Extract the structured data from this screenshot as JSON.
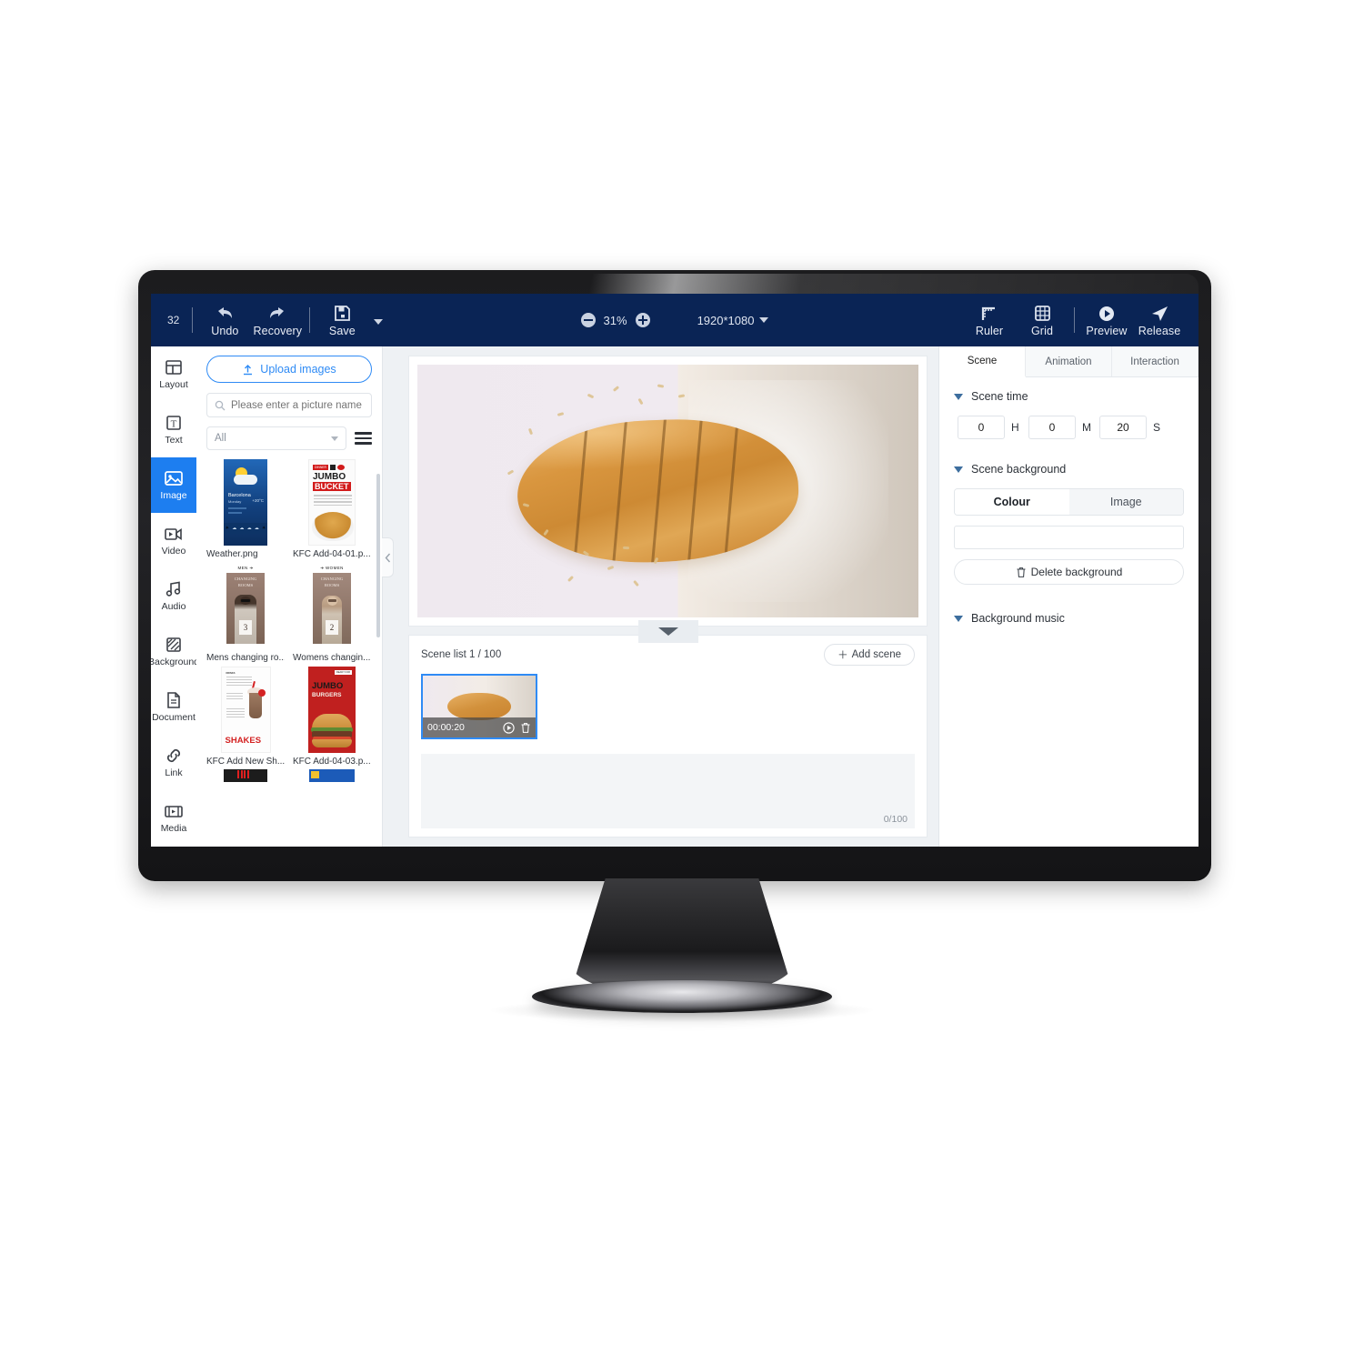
{
  "toolbar": {
    "left_number": "32",
    "undo_label": "Undo",
    "recovery_label": "Recovery",
    "save_label": "Save",
    "zoom_level": "31%",
    "resolution": "1920*1080",
    "ruler_label": "Ruler",
    "grid_label": "Grid",
    "preview_label": "Preview",
    "release_label": "Release",
    "bg_color": "#0a2455"
  },
  "rail": {
    "items": [
      {
        "label": "Layout",
        "icon": "layout-icon",
        "active": false
      },
      {
        "label": "Text",
        "icon": "text-icon",
        "active": false
      },
      {
        "label": "Image",
        "icon": "image-icon",
        "active": true
      },
      {
        "label": "Video",
        "icon": "video-icon",
        "active": false
      },
      {
        "label": "Audio",
        "icon": "audio-icon",
        "active": false
      },
      {
        "label": "Background",
        "icon": "background-icon",
        "active": false
      },
      {
        "label": "Document",
        "icon": "document-icon",
        "active": false
      },
      {
        "label": "Link",
        "icon": "link-icon",
        "active": false
      },
      {
        "label": "Media",
        "icon": "media-icon",
        "active": false
      }
    ],
    "active_color": "#1d7ef0"
  },
  "image_panel": {
    "upload_label": "Upload images",
    "search_placeholder": "Please enter a picture name",
    "filter_value": "All",
    "thumbnails": [
      {
        "name": "Weather.png",
        "kind": "weather-widget"
      },
      {
        "name": "KFC Add-04-01.p...",
        "kind": "jumbo-bucket"
      },
      {
        "name": "Mens changing ro...",
        "kind": "mens-changing-room"
      },
      {
        "name": "Womens changin...",
        "kind": "womens-changing-room"
      },
      {
        "name": "KFC Add New Sh...",
        "kind": "shakes-menu"
      },
      {
        "name": "KFC Add-04-03.p...",
        "kind": "jumbo-burgers"
      }
    ],
    "thumb_text": {
      "weather_city": "Barcelona",
      "weather_day": "Monday",
      "weather_temp": "+20°C",
      "bucket_brand": "DINNER",
      "bucket_line1": "JUMBO",
      "bucket_line2": "BUCKET",
      "men_tag": "MEN",
      "women_tag": "WOMEN",
      "changing_line1": "CHANGING",
      "changing_line2": "ROOMS",
      "men_number": "3",
      "women_number": "2",
      "shakes_title": "SHAKES",
      "burgers_tagline": "READY FOR",
      "burgers_line1": "JUMBO",
      "burgers_line2": "BURGERS"
    }
  },
  "canvas": {
    "image_alt": "Sliced artisan bread loaf with scattered oats on lavender and beige background"
  },
  "scene_panel": {
    "list_label": "Scene list 1 / 100",
    "add_scene_label": "Add scene",
    "scene_duration": "00:00:20",
    "drop_counter": "0/100"
  },
  "right_panel": {
    "tabs": [
      {
        "label": "Scene",
        "active": true
      },
      {
        "label": "Animation",
        "active": false
      },
      {
        "label": "Interaction",
        "active": false
      }
    ],
    "scene_time": {
      "title": "Scene time",
      "hours": "0",
      "hours_unit": "H",
      "minutes": "0",
      "minutes_unit": "M",
      "seconds": "20",
      "seconds_unit": "S"
    },
    "scene_background": {
      "title": "Scene background",
      "colour_tab": "Colour",
      "image_tab": "Image",
      "delete_label": "Delete background"
    },
    "background_music": {
      "title": "Background music"
    }
  }
}
